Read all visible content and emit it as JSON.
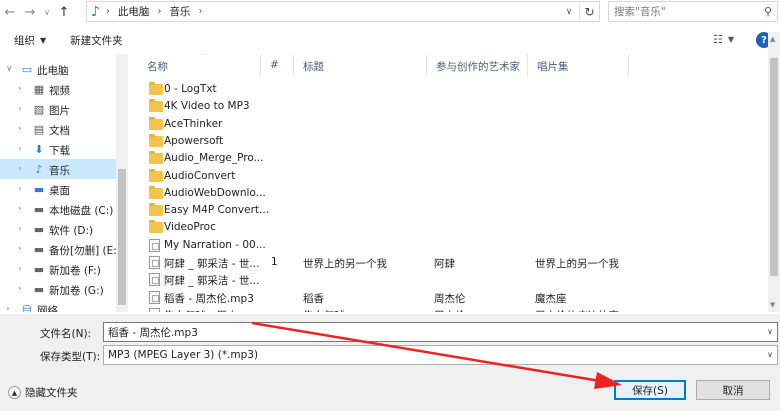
{
  "address": {
    "crumbs": [
      "此电脑",
      "音乐"
    ],
    "search_placeholder": "搜索\"音乐\""
  },
  "toolbar": {
    "organize": "组织",
    "new_folder": "新建文件夹"
  },
  "nav": {
    "items": [
      {
        "label": "此电脑",
        "icon": "computer-icon",
        "level": 0,
        "selected": false
      },
      {
        "label": "视频",
        "icon": "video-icon",
        "level": 1,
        "selected": false
      },
      {
        "label": "图片",
        "icon": "pictures-icon",
        "level": 1,
        "selected": false
      },
      {
        "label": "文档",
        "icon": "documents-icon",
        "level": 1,
        "selected": false
      },
      {
        "label": "下载",
        "icon": "download-icon",
        "level": 1,
        "selected": false
      },
      {
        "label": "音乐",
        "icon": "music-icon",
        "level": 1,
        "selected": true
      },
      {
        "label": "桌面",
        "icon": "desktop-icon",
        "level": 1,
        "selected": false
      },
      {
        "label": "本地磁盘 (C:)",
        "icon": "drive-icon",
        "level": 1,
        "selected": false
      },
      {
        "label": "软件 (D:)",
        "icon": "drive-icon",
        "level": 1,
        "selected": false
      },
      {
        "label": "备份[勿删] (E:)",
        "icon": "drive-icon",
        "level": 1,
        "selected": false
      },
      {
        "label": "新加卷 (F:)",
        "icon": "drive-icon",
        "level": 1,
        "selected": false
      },
      {
        "label": "新加卷 (G:)",
        "icon": "drive-icon",
        "level": 1,
        "selected": false
      },
      {
        "label": "网络",
        "icon": "network-icon",
        "level": 0,
        "selected": false
      }
    ]
  },
  "columns": {
    "name": "名称",
    "num": "#",
    "title": "标题",
    "artists": "参与创作的艺术家",
    "album": "唱片集"
  },
  "files": [
    {
      "name": "0 - LogTxt",
      "type": "folder",
      "num": "",
      "title": "",
      "artist": "",
      "album": ""
    },
    {
      "name": "4K Video to MP3",
      "type": "folder",
      "num": "",
      "title": "",
      "artist": "",
      "album": ""
    },
    {
      "name": "AceThinker",
      "type": "folder",
      "num": "",
      "title": "",
      "artist": "",
      "album": ""
    },
    {
      "name": "Apowersoft",
      "type": "folder",
      "num": "",
      "title": "",
      "artist": "",
      "album": ""
    },
    {
      "name": "Audio_Merge_Pro...",
      "type": "folder",
      "num": "",
      "title": "",
      "artist": "",
      "album": ""
    },
    {
      "name": "AudioConvert",
      "type": "folder",
      "num": "",
      "title": "",
      "artist": "",
      "album": ""
    },
    {
      "name": "AudioWebDownlo...",
      "type": "folder",
      "num": "",
      "title": "",
      "artist": "",
      "album": ""
    },
    {
      "name": "Easy M4P Convert...",
      "type": "folder",
      "num": "",
      "title": "",
      "artist": "",
      "album": ""
    },
    {
      "name": "VideoProc",
      "type": "folder",
      "num": "",
      "title": "",
      "artist": "",
      "album": ""
    },
    {
      "name": "My Narration - 00...",
      "type": "file",
      "num": "",
      "title": "",
      "artist": "",
      "album": ""
    },
    {
      "name": "阿肆 _ 郭采洁 - 世...",
      "type": "file",
      "num": "1",
      "title": "世界上的另一个我",
      "artist": "阿肆",
      "album": "世界上的另一个我"
    },
    {
      "name": "阿肆 _ 郭采洁 - 世...",
      "type": "file",
      "num": "",
      "title": "",
      "artist": "",
      "album": ""
    },
    {
      "name": "稻香 - 周杰伦.mp3",
      "type": "file",
      "num": "",
      "title": "稻香",
      "artist": "周杰伦",
      "album": "魔杰座"
    },
    {
      "name": "告白气球 - 周杰...",
      "type": "file",
      "num": "",
      "title": "告白气球",
      "artist": "周杰伦",
      "album": "周杰伦的床边故事"
    }
  ],
  "bottom": {
    "filename_label": "文件名(N):",
    "filename_value": "稻香 - 周杰伦.mp3",
    "filetype_label": "保存类型(T):",
    "filetype_value": "MP3 (MPEG Layer 3) (*.mp3)",
    "hide_folders": "隐藏文件夹",
    "save": "保存(S)",
    "cancel": "取消"
  },
  "colors": {
    "accent": "#0078d7",
    "selection": "#cce8ff",
    "annotation_arrow": "#ee2222"
  }
}
